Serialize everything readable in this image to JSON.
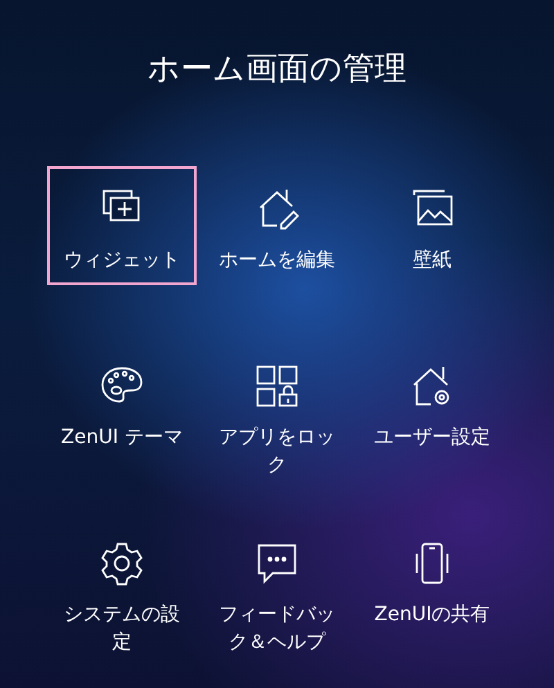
{
  "title": "ホーム画面の管理",
  "items": [
    {
      "label": "ウィジェット",
      "selected": true
    },
    {
      "label": "ホームを編集",
      "selected": false
    },
    {
      "label": "壁紙",
      "selected": false
    },
    {
      "label": "ZenUI テーマ",
      "selected": false
    },
    {
      "label": "アプリをロック",
      "selected": false
    },
    {
      "label": "ユーザー設定",
      "selected": false
    },
    {
      "label": "システムの設定",
      "selected": false
    },
    {
      "label": "フィードバック＆ヘルプ",
      "selected": false
    },
    {
      "label": "ZenUIの共有",
      "selected": false
    }
  ]
}
